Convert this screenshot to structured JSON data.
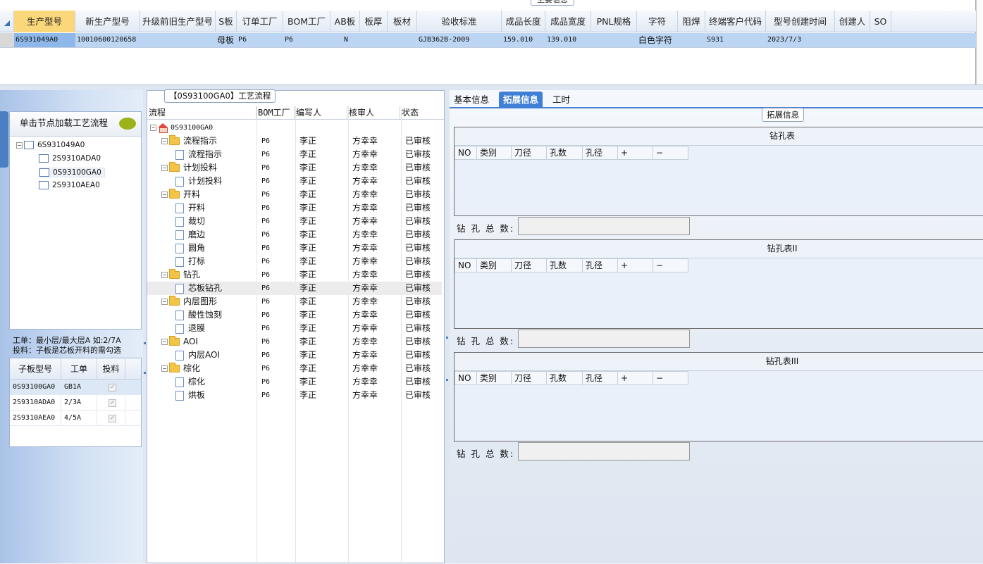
{
  "top": {
    "section_tab": "主要信息",
    "columns": [
      "生产型号",
      "新生产型号",
      "升级前旧生产型号",
      "S板",
      "订单工厂",
      "BOM工厂",
      "AB板",
      "板厚",
      "板材",
      "验收标准",
      "成品长度",
      "成品宽度",
      "PNL规格",
      "字符",
      "阻焊",
      "终端客户代码",
      "型号创建时间",
      "创建人",
      "SO"
    ],
    "row": [
      "6S931049A0",
      "10010600120658",
      "",
      "母板",
      "P6",
      "P6",
      "N",
      "",
      "",
      "GJB362B-2009",
      "159.010",
      "139.010",
      "",
      "白色字符",
      "",
      "S931",
      "2023/7/3",
      "",
      ""
    ]
  },
  "left": {
    "header": "单击节点加载工艺流程",
    "tree": {
      "root": "6S931049A0",
      "children": [
        "2S9310ADA0",
        "0S93100GA0",
        "2S9310AEA0"
      ]
    },
    "note_line1": "工单：最小层/最大层A 如:2/7A",
    "note_line2": "投料：子板是芯板开料的需勾选",
    "subtable": {
      "headers": [
        "子板型号",
        "工单",
        "投料"
      ],
      "rows": [
        {
          "model": "0S93100GA0",
          "order": "GB1A"
        },
        {
          "model": "2S9310ADA0",
          "order": "2/3A"
        },
        {
          "model": "2S9310AEA0",
          "order": "4/5A"
        }
      ]
    }
  },
  "middle": {
    "title": "【0S93100GA0】工艺流程",
    "headers": [
      "流程",
      "BOM工厂",
      "编写人",
      "核审人",
      "状态"
    ],
    "root": "0S93100GA0",
    "rows": [
      {
        "name": "流程指示",
        "type": "folder",
        "bom": "P6",
        "writer": "李正",
        "reviewer": "方幸幸",
        "status": "已审核"
      },
      {
        "name": "流程指示",
        "type": "doc",
        "bom": "P6",
        "writer": "李正",
        "reviewer": "方幸幸",
        "status": "已审核"
      },
      {
        "name": "计划投料",
        "type": "folder",
        "bom": "P6",
        "writer": "李正",
        "reviewer": "方幸幸",
        "status": "已审核"
      },
      {
        "name": "计划投料",
        "type": "doc",
        "bom": "P6",
        "writer": "李正",
        "reviewer": "方幸幸",
        "status": "已审核"
      },
      {
        "name": "开料",
        "type": "folder",
        "bom": "P6",
        "writer": "李正",
        "reviewer": "方幸幸",
        "status": "已审核"
      },
      {
        "name": "开料",
        "type": "doc",
        "bom": "P6",
        "writer": "李正",
        "reviewer": "方幸幸",
        "status": "已审核"
      },
      {
        "name": "裁切",
        "type": "doc",
        "bom": "P6",
        "writer": "李正",
        "reviewer": "方幸幸",
        "status": "已审核"
      },
      {
        "name": "磨边",
        "type": "doc",
        "bom": "P6",
        "writer": "李正",
        "reviewer": "方幸幸",
        "status": "已审核"
      },
      {
        "name": "圆角",
        "type": "doc",
        "bom": "P6",
        "writer": "李正",
        "reviewer": "方幸幸",
        "status": "已审核"
      },
      {
        "name": "打标",
        "type": "doc",
        "bom": "P6",
        "writer": "李正",
        "reviewer": "方幸幸",
        "status": "已审核"
      },
      {
        "name": "钻孔",
        "type": "folder",
        "bom": "P6",
        "writer": "李正",
        "reviewer": "方幸幸",
        "status": "已审核"
      },
      {
        "name": "芯板钻孔",
        "type": "doc",
        "bom": "P6",
        "writer": "李正",
        "reviewer": "方幸幸",
        "status": "已审核",
        "selected": true
      },
      {
        "name": "内层图形",
        "type": "folder",
        "bom": "P6",
        "writer": "李正",
        "reviewer": "方幸幸",
        "status": "已审核"
      },
      {
        "name": "酸性蚀刻",
        "type": "doc",
        "bom": "P6",
        "writer": "李正",
        "reviewer": "方幸幸",
        "status": "已审核"
      },
      {
        "name": "退膜",
        "type": "doc",
        "bom": "P6",
        "writer": "李正",
        "reviewer": "方幸幸",
        "status": "已审核"
      },
      {
        "name": "AOI",
        "type": "folder",
        "bom": "P6",
        "writer": "李正",
        "reviewer": "方幸幸",
        "status": "已审核"
      },
      {
        "name": "内层AOI",
        "type": "doc",
        "bom": "P6",
        "writer": "李正",
        "reviewer": "方幸幸",
        "status": "已审核"
      },
      {
        "name": "棕化",
        "type": "folder",
        "bom": "P6",
        "writer": "李正",
        "reviewer": "方幸幸",
        "status": "已审核"
      },
      {
        "name": "棕化",
        "type": "doc",
        "bom": "P6",
        "writer": "李正",
        "reviewer": "方幸幸",
        "status": "已审核"
      },
      {
        "name": "烘板",
        "type": "doc",
        "bom": "P6",
        "writer": "李正",
        "reviewer": "方幸幸",
        "status": "已审核"
      }
    ]
  },
  "right": {
    "tabs": [
      "基本信息",
      "拓展信息",
      "工时"
    ],
    "active_tab": "拓展信息",
    "section_title": "拓展信息",
    "drill_headers": [
      "NO",
      "类别",
      "刀径",
      "孔数",
      "孔径",
      "+",
      "−"
    ],
    "total_label": "钻 孔 总 数:",
    "tables": [
      "钻孔表",
      "钻孔表II",
      "钻孔表III"
    ]
  }
}
